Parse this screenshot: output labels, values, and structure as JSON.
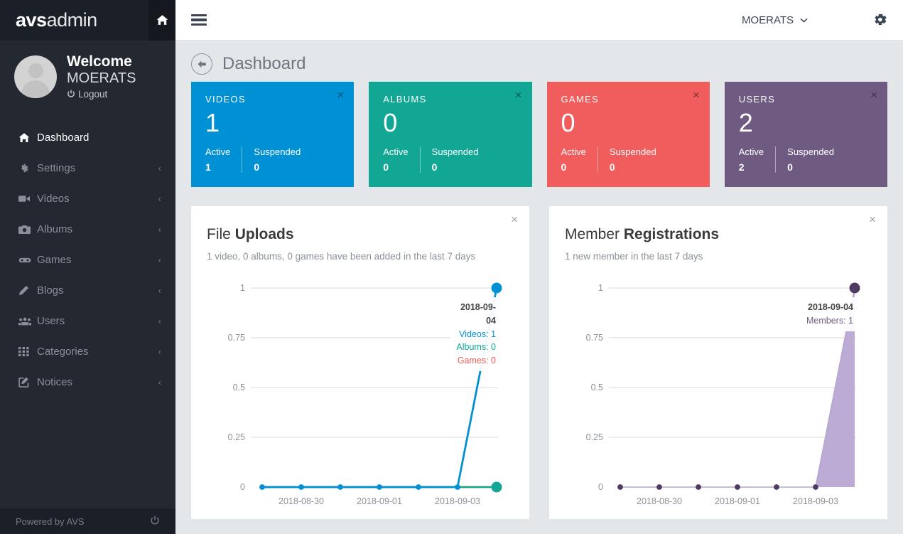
{
  "sidebar": {
    "brand_bold": "avs",
    "brand_light": "admin",
    "home_icon": "home-icon",
    "welcome": "Welcome",
    "username": "MOERATS",
    "logout": "Logout",
    "items": [
      {
        "label": "Dashboard",
        "icon": "home-icon",
        "caret": "",
        "active": true
      },
      {
        "label": "Settings",
        "icon": "gear-icon",
        "caret": "‹",
        "active": false
      },
      {
        "label": "Videos",
        "icon": "video-camera-icon",
        "caret": "‹",
        "active": false
      },
      {
        "label": "Albums",
        "icon": "camera-icon",
        "caret": "‹",
        "active": false
      },
      {
        "label": "Games",
        "icon": "gamepad-icon",
        "caret": "‹",
        "active": false
      },
      {
        "label": "Blogs",
        "icon": "pencil-icon",
        "caret": "‹",
        "active": false
      },
      {
        "label": "Users",
        "icon": "users-icon",
        "caret": "‹",
        "active": false
      },
      {
        "label": "Categories",
        "icon": "grid-icon",
        "caret": "‹",
        "active": false
      },
      {
        "label": "Notices",
        "icon": "edit-square-icon",
        "caret": "‹",
        "active": false
      }
    ],
    "footer_text": "Powered by AVS",
    "footer_icon": "power-icon"
  },
  "topbar": {
    "menu_icon": "hamburger-icon",
    "user": "MOERATS",
    "caret_icon": "chevron-down-icon",
    "settings_icon": "gear-icon"
  },
  "page": {
    "back_icon": "arrow-left-circle-icon",
    "title": "Dashboard"
  },
  "cards": [
    {
      "title": "VIDEOS",
      "total": "1",
      "active_label": "Active",
      "active_value": "1",
      "suspended_label": "Suspended",
      "suspended_value": "0",
      "color": "#0091d5",
      "close": "×"
    },
    {
      "title": "ALBUMS",
      "total": "0",
      "active_label": "Active",
      "active_value": "0",
      "suspended_label": "Suspended",
      "suspended_value": "0",
      "color": "#12a794",
      "close": "×"
    },
    {
      "title": "GAMES",
      "total": "0",
      "active_label": "Active",
      "active_value": "0",
      "suspended_label": "Suspended",
      "suspended_value": "0",
      "color": "#f15c5c",
      "close": "×"
    },
    {
      "title": "USERS",
      "total": "2",
      "active_label": "Active",
      "active_value": "2",
      "suspended_label": "Suspended",
      "suspended_value": "0",
      "color": "#6f5b82",
      "close": "×"
    }
  ],
  "uploads_panel": {
    "title_light": "File ",
    "title_bold": "Uploads",
    "subtitle": "1 video, 0 albums, 0 games have been added in the last 7 days",
    "close": "×",
    "tooltip": {
      "date": "2018-09-04",
      "rows": [
        {
          "text": "Videos: 1",
          "color": "#0091d5"
        },
        {
          "text": "Albums: 0",
          "color": "#12a794"
        },
        {
          "text": "Games: 0",
          "color": "#f15c5c"
        }
      ]
    }
  },
  "members_panel": {
    "title_light": "Member ",
    "title_bold": "Registrations",
    "subtitle": "1 new member in the last 7 days",
    "close": "×",
    "tooltip": {
      "date": "2018-09-04",
      "rows": [
        {
          "text": "Members: 1",
          "color": "#6f5b82"
        }
      ]
    }
  },
  "chart_data": [
    {
      "type": "line",
      "title": "File Uploads",
      "subtitle": "1 video, 0 albums, 0 games have been added in the last 7 days",
      "x": [
        "2018-08-29",
        "2018-08-30",
        "2018-08-31",
        "2018-09-01",
        "2018-09-02",
        "2018-09-03",
        "2018-09-04"
      ],
      "xtick_labels": [
        "",
        "2018-08-30",
        "",
        "2018-09-01",
        "",
        "2018-09-03",
        ""
      ],
      "ytick_labels": [
        "0",
        "0.25",
        "0.5",
        "0.75",
        "1"
      ],
      "ytick_values": [
        0,
        0.25,
        0.5,
        0.75,
        1
      ],
      "ylim": [
        0,
        1
      ],
      "grid": true,
      "legend": "none",
      "series": [
        {
          "name": "Videos",
          "color": "#0091d5",
          "values": [
            0,
            0,
            0,
            0,
            0,
            0,
            1
          ]
        },
        {
          "name": "Albums",
          "color": "#12a794",
          "values": [
            0,
            0,
            0,
            0,
            0,
            0,
            0
          ]
        },
        {
          "name": "Games",
          "color": "#f15c5c",
          "values": [
            0,
            0,
            0,
            0,
            0,
            0,
            0
          ]
        }
      ]
    },
    {
      "type": "area",
      "title": "Member Registrations",
      "subtitle": "1 new member in the last 7 days",
      "x": [
        "2018-08-29",
        "2018-08-30",
        "2018-08-31",
        "2018-09-01",
        "2018-09-02",
        "2018-09-03",
        "2018-09-04"
      ],
      "xtick_labels": [
        "",
        "2018-08-30",
        "",
        "2018-09-01",
        "",
        "2018-09-03",
        ""
      ],
      "ytick_labels": [
        "0",
        "0.25",
        "0.5",
        "0.75",
        "1"
      ],
      "ytick_values": [
        0,
        0.25,
        0.5,
        0.75,
        1
      ],
      "ylim": [
        0,
        1
      ],
      "grid": true,
      "legend": "none",
      "series": [
        {
          "name": "Members",
          "color": "#6f5b82",
          "fill": "#bcabd4",
          "values": [
            0,
            0,
            0,
            0,
            0,
            0,
            1
          ]
        }
      ]
    }
  ]
}
